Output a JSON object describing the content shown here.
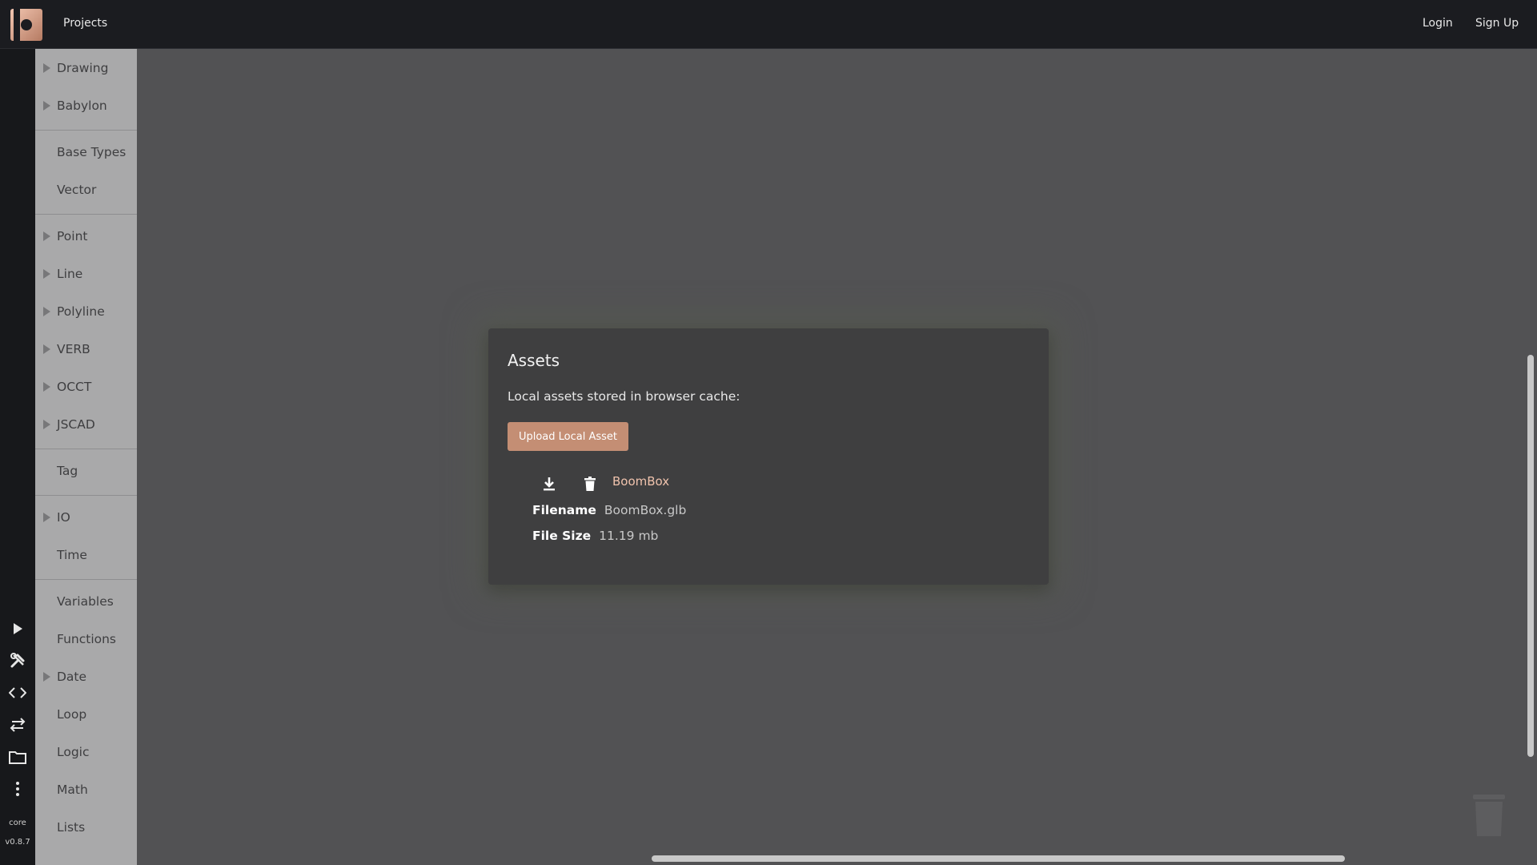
{
  "topbar": {
    "projects_label": "Projects",
    "login_label": "Login",
    "signup_label": "Sign Up"
  },
  "rail": {
    "icons": [
      "play-icon",
      "tools-icon",
      "code-icon",
      "swap-icon",
      "folder-icon",
      "more-vertical-icon"
    ],
    "core_label": "core",
    "version_label": "v0.8.7"
  },
  "categories": [
    {
      "label": "Drawing",
      "expandable": true
    },
    {
      "label": "Babylon",
      "expandable": true
    },
    {
      "label": "Base Types",
      "expandable": false
    },
    {
      "label": "Vector",
      "expandable": false
    },
    {
      "label": "Point",
      "expandable": true
    },
    {
      "label": "Line",
      "expandable": true
    },
    {
      "label": "Polyline",
      "expandable": true
    },
    {
      "label": "VERB",
      "expandable": true
    },
    {
      "label": "OCCT",
      "expandable": true
    },
    {
      "label": "JSCAD",
      "expandable": true
    },
    {
      "label": "Tag",
      "expandable": false
    },
    {
      "label": "IO",
      "expandable": true
    },
    {
      "label": "Time",
      "expandable": false
    },
    {
      "label": "Variables",
      "expandable": false
    },
    {
      "label": "Functions",
      "expandable": false
    },
    {
      "label": "Date",
      "expandable": true
    },
    {
      "label": "Loop",
      "expandable": false
    },
    {
      "label": "Logic",
      "expandable": false
    },
    {
      "label": "Math",
      "expandable": false
    },
    {
      "label": "Lists",
      "expandable": false
    }
  ],
  "dialog": {
    "title": "Assets",
    "description": "Local assets stored in browser cache:",
    "upload_button": "Upload Local Asset",
    "asset": {
      "name": "BoomBox",
      "filename_label": "Filename",
      "filename": "BoomBox.glb",
      "filesize_label": "File Size",
      "filesize": "11.19 mb"
    }
  },
  "colors": {
    "topbar_bg": "#1b1c20",
    "workspace_bg": "#525254",
    "category_bg": "#a9a9aa",
    "dialog_bg": "#3f3f40",
    "accent": "#c48e74",
    "asset_link": "#f0c3ad"
  }
}
